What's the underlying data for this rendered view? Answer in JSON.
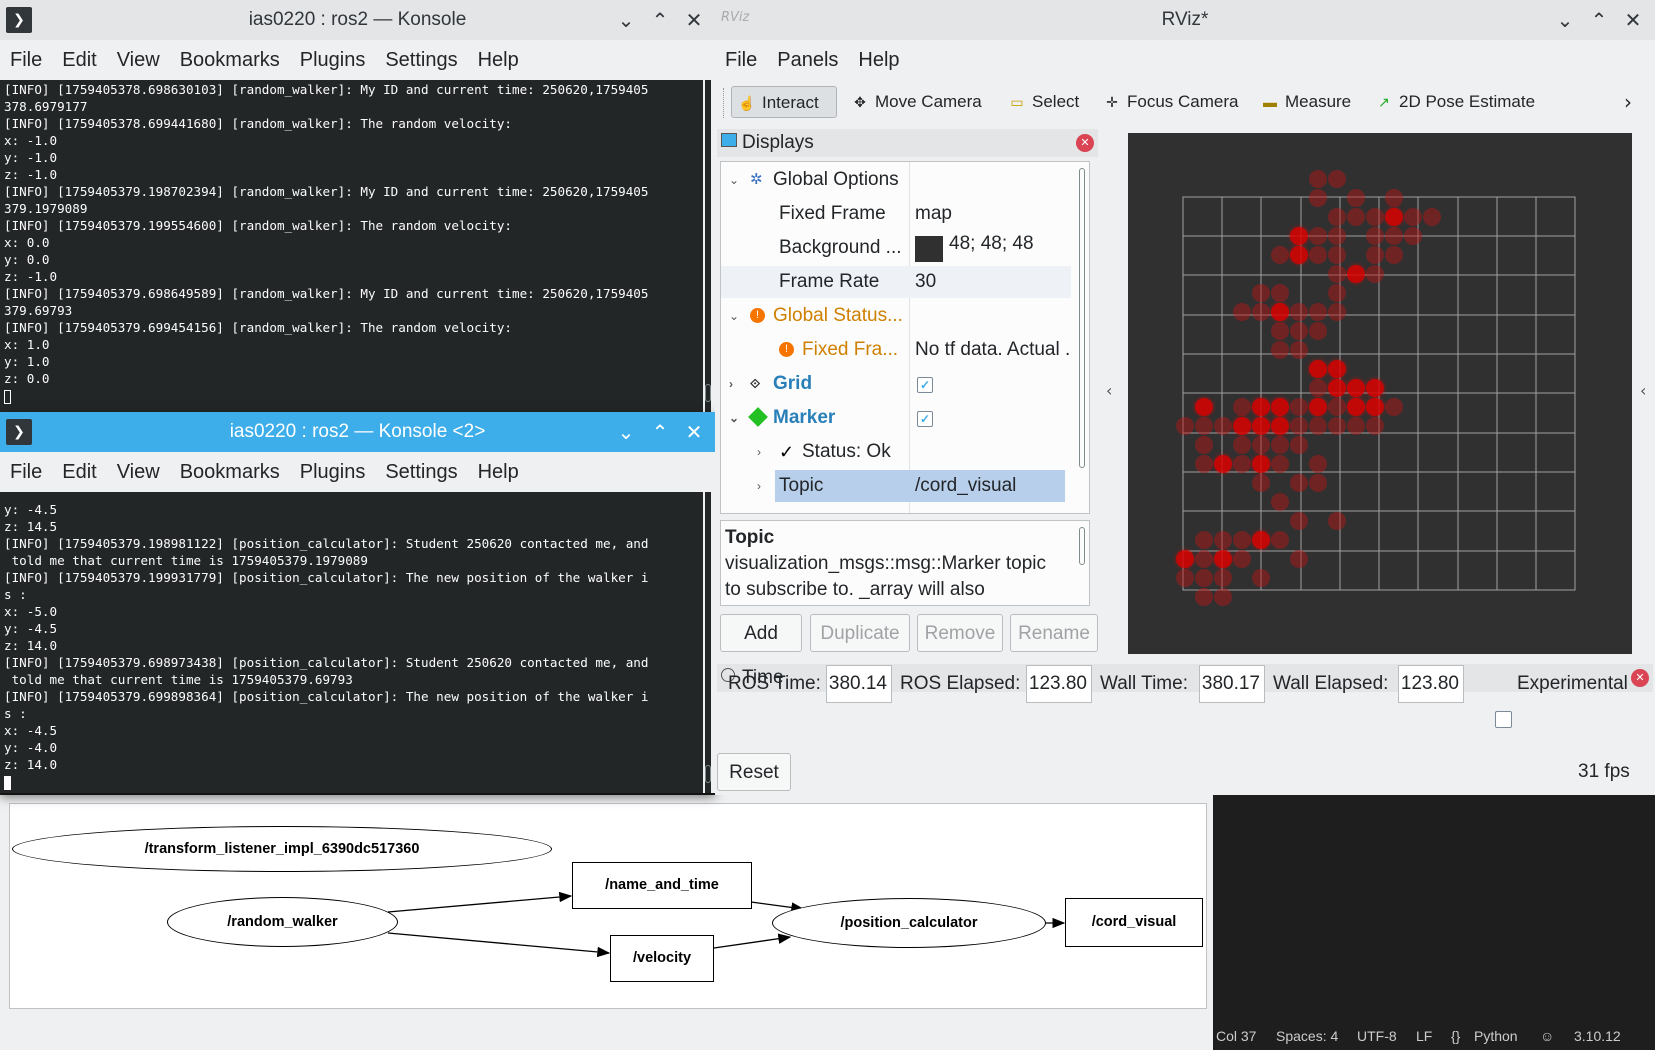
{
  "konsole1": {
    "title": "ias0220 : ros2 — Konsole",
    "menu": [
      "File",
      "Edit",
      "View",
      "Bookmarks",
      "Plugins",
      "Settings",
      "Help"
    ],
    "lines": [
      "[INFO] [1759405378.698630103] [random_walker]: My ID and current time: 250620,1759405",
      "378.6979177",
      "[INFO] [1759405378.699441680] [random_walker]: The random velocity:",
      "x: -1.0",
      "y: -1.0",
      "z: -1.0",
      "[INFO] [1759405379.198702394] [random_walker]: My ID and current time: 250620,1759405",
      "379.1979089",
      "[INFO] [1759405379.199554600] [random_walker]: The random velocity:",
      "x: 0.0",
      "y: 0.0",
      "z: -1.0",
      "[INFO] [1759405379.698649589] [random_walker]: My ID and current time: 250620,1759405",
      "379.69793",
      "[INFO] [1759405379.699454156] [random_walker]: The random velocity:",
      "x: 1.0",
      "y: 1.0",
      "z: 0.0"
    ]
  },
  "konsole2": {
    "title": "ias0220 : ros2 — Konsole <2>",
    "menu": [
      "File",
      "Edit",
      "View",
      "Bookmarks",
      "Plugins",
      "Settings",
      "Help"
    ],
    "lines": [
      "y: -4.5",
      "z: 14.5",
      "[INFO] [1759405379.198981122] [position_calculator]: Student 250620 contacted me, and",
      " told me that current time is 1759405379.1979089",
      "[INFO] [1759405379.199931779] [position_calculator]: The new position of the walker i",
      "s :",
      "x: -5.0",
      "y: -4.5",
      "z: 14.0",
      "[INFO] [1759405379.698973438] [position_calculator]: Student 250620 contacted me, and",
      " told me that current time is 1759405379.69793",
      "[INFO] [1759405379.699898364] [position_calculator]: The new position of the walker i",
      "s :",
      "x: -4.5",
      "y: -4.0",
      "z: 14.0"
    ]
  },
  "rviz": {
    "title": "RViz*",
    "menu": [
      "File",
      "Panels",
      "Help"
    ],
    "toolbar": [
      "Interact",
      "Move Camera",
      "Select",
      "Focus Camera",
      "Measure",
      "2D Pose Estimate"
    ],
    "displays_title": "Displays",
    "tree": {
      "global_options": "Global Options",
      "fixed_frame_label": "Fixed Frame",
      "fixed_frame_value": "map",
      "background_label": "Background ...",
      "background_value": "48; 48; 48",
      "background_color": "#303030",
      "frame_rate_label": "Frame Rate",
      "frame_rate_value": "30",
      "global_status": "Global Status...",
      "fixed_fra_label": "Fixed Fra...",
      "fixed_fra_value": "No tf data.  Actual ...",
      "grid": "Grid",
      "marker": "Marker",
      "status_ok": "Status: Ok",
      "topic_label": "Topic",
      "topic_value": "/cord_visual"
    },
    "description": {
      "title": "Topic",
      "line1": "visualization_msgs::msg::Marker topic",
      "line2": "to subscribe to. _array will also"
    },
    "buttons": {
      "add": "Add",
      "duplicate": "Duplicate",
      "remove": "Remove",
      "rename": "Rename"
    },
    "time": {
      "title": "Time",
      "ros_time_label": "ROS Time:",
      "ros_time": "380.14",
      "ros_elapsed_label": "ROS Elapsed:",
      "ros_elapsed": "123.80",
      "wall_time_label": "Wall Time:",
      "wall_time": "380.17",
      "wall_elapsed_label": "Wall Elapsed:",
      "wall_elapsed": "123.80",
      "experimental": "Experimental",
      "reset": "Reset",
      "fps": "31 fps"
    }
  },
  "graph": {
    "nodes": {
      "transform_listener": "/transform_listener_impl_6390dc517360",
      "random_walker": "/random_walker",
      "name_and_time": "/name_and_time",
      "velocity": "/velocity",
      "position_calculator": "/position_calculator",
      "cord_visual": "/cord_visual"
    }
  },
  "statusbar": {
    "col": "Col 37",
    "spaces": "Spaces: 4",
    "encoding": "UTF-8",
    "eol": "LF",
    "language": "Python",
    "version": "3.10.12"
  },
  "colors": {
    "kde_accent": "#3daee9",
    "terminal_bg": "#232627",
    "rviz_bg": "#303030",
    "warning": "#f67400",
    "link_blue": "#2980b9"
  }
}
